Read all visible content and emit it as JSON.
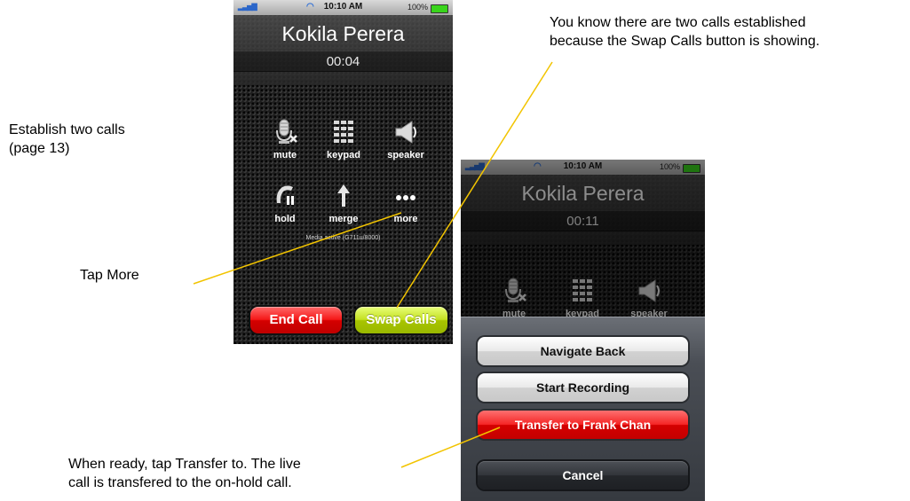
{
  "annotations": {
    "establish": [
      "Establish two calls",
      "(page 13)"
    ],
    "tap_more": "Tap More",
    "swap_note": [
      "You know there are two calls established",
      "because the Swap Calls button is showing."
    ],
    "transfer_note": [
      "When ready, tap Transfer to. The live",
      "call is transfered to the on-hold call."
    ]
  },
  "phone1": {
    "status": {
      "time": "10:10 AM",
      "battery": "100%"
    },
    "caller_name": "Kokila Perera",
    "call_timer": "00:04",
    "controls": [
      {
        "label": "mute",
        "icon": "microphone-mute-icon"
      },
      {
        "label": "keypad",
        "icon": "keypad-icon"
      },
      {
        "label": "speaker",
        "icon": "speaker-icon"
      },
      {
        "label": "hold",
        "icon": "hold-icon"
      },
      {
        "label": "merge",
        "icon": "merge-icon"
      },
      {
        "label": "more",
        "icon": "more-icon"
      }
    ],
    "media_status": "Media active (G711u/8000)",
    "end_call_label": "End Call",
    "swap_calls_label": "Swap Calls"
  },
  "phone2": {
    "status": {
      "time": "10:10 AM",
      "battery": "100%"
    },
    "caller_name": "Kokila Perera",
    "call_timer": "00:11",
    "controls": [
      {
        "label": "mute",
        "icon": "microphone-mute-icon"
      },
      {
        "label": "keypad",
        "icon": "keypad-icon"
      },
      {
        "label": "speaker",
        "icon": "speaker-icon"
      }
    ],
    "sheet": {
      "navigate_back": "Navigate Back",
      "start_recording": "Start Recording",
      "transfer": "Transfer to Frank Chan",
      "cancel": "Cancel"
    }
  },
  "colors": {
    "end_call": "#e00000",
    "swap_calls": "#b4d200",
    "transfer": "#e00000",
    "leader_line": "#f2c400"
  }
}
